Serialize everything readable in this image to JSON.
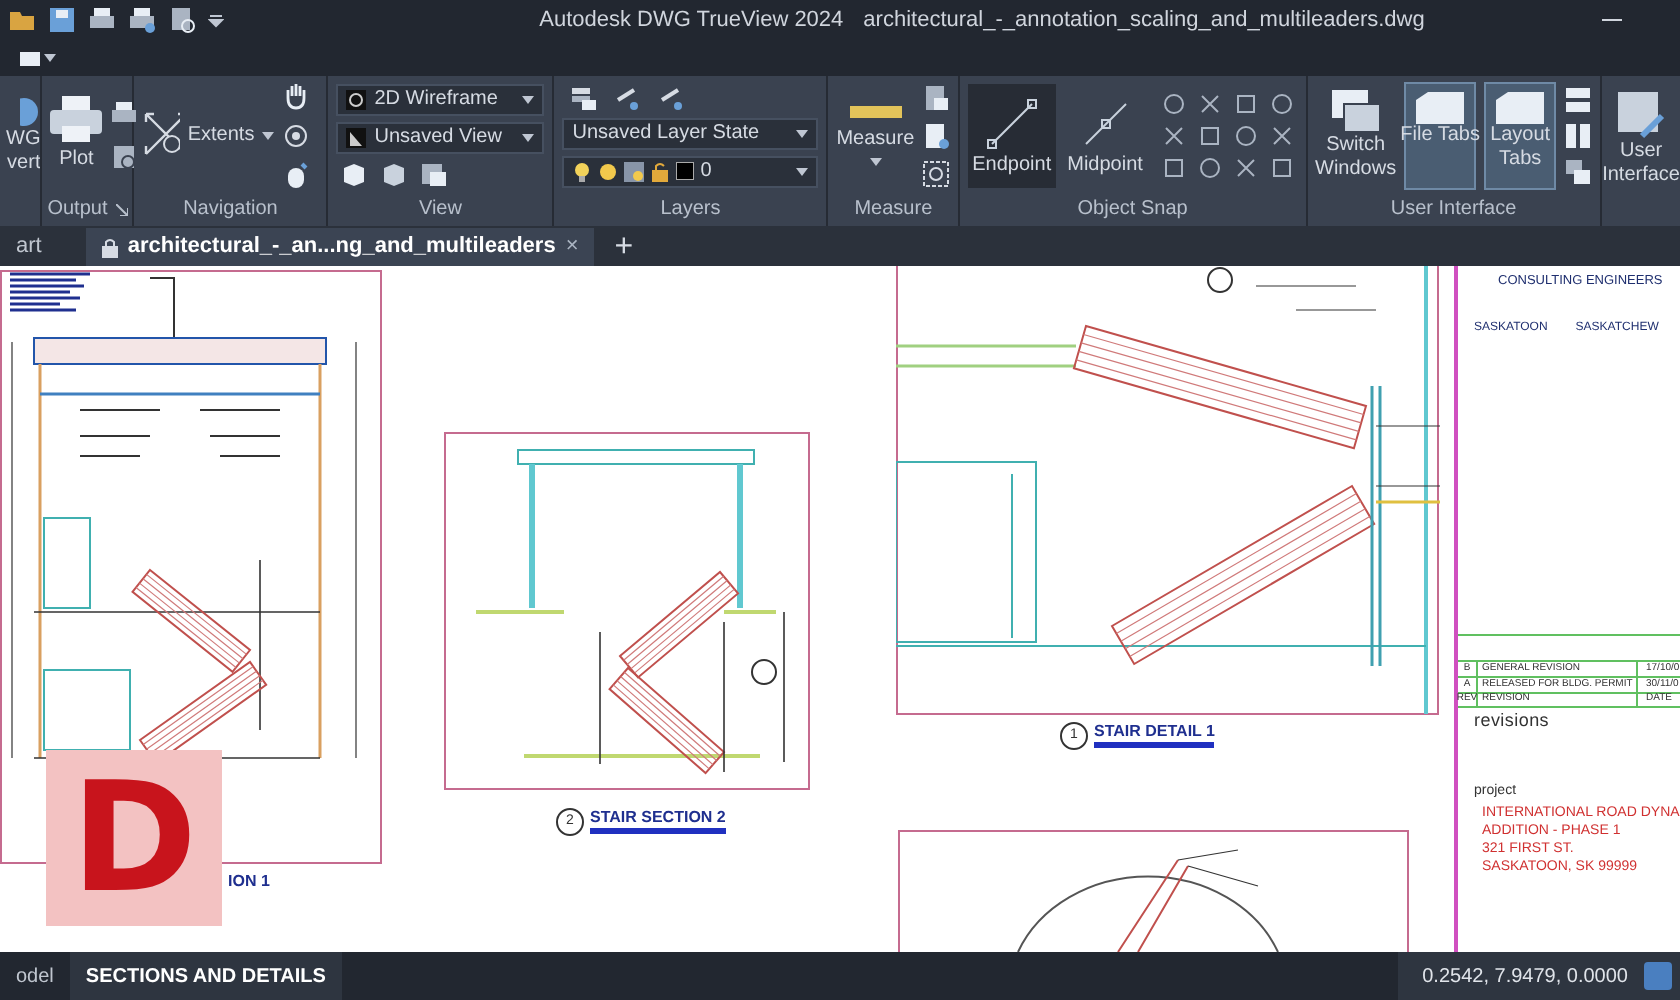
{
  "title_bar": {
    "app_title": "Autodesk DWG TrueView 2024",
    "file_name": "architectural_-_annotation_scaling_and_multileaders.dwg"
  },
  "ribbon": {
    "convert": {
      "lines": [
        "WG",
        "vert"
      ]
    },
    "output": {
      "title": "Output",
      "plot": "Plot"
    },
    "navigation": {
      "title": "Navigation",
      "extents": "Extents"
    },
    "view": {
      "title": "View",
      "visual_style": "2D Wireframe",
      "named_view": "Unsaved View"
    },
    "layers": {
      "title": "Layers",
      "layer_state": "Unsaved Layer State",
      "current_layer": "0"
    },
    "measure": {
      "title": "Measure",
      "label": "Measure"
    },
    "object_snap": {
      "title": "Object Snap",
      "snaps": [
        {
          "label": "Endpoint",
          "selected": true
        },
        {
          "label": "Midpoint",
          "selected": false
        }
      ]
    },
    "user_interface": {
      "title": "User Interface",
      "switch_windows": [
        "Switch",
        "Windows"
      ],
      "toggles": [
        {
          "lines": [
            "File Tabs"
          ],
          "selected": true
        },
        {
          "lines": [
            "Layout",
            "Tabs"
          ],
          "selected": true
        }
      ],
      "ui_button": [
        "User",
        "Interface"
      ]
    }
  },
  "file_tabs": [
    {
      "label": "art",
      "selected": false,
      "locked": false
    },
    {
      "label": "architectural_-_an...ng_and_multileaders",
      "selected": true,
      "locked": true,
      "close": "×"
    }
  ],
  "new_tab": "+",
  "drawing": {
    "section_1_label": "ION 1",
    "section_2": {
      "number": "2",
      "title": "STAIR SECTION 2"
    },
    "detail_1": {
      "number": "1",
      "title": "STAIR DETAIL 1"
    },
    "title_block": {
      "firm": "CONSULTING ENGINEERS",
      "cities": [
        "SASKATOON",
        "SASKATCHEW"
      ],
      "revisions": [
        {
          "mark": "B",
          "description": "GENERAL REVISION",
          "date": "17/10/0"
        },
        {
          "mark": "A",
          "description": "RELEASED FOR BLDG. PERMIT",
          "date": "30/11/0"
        }
      ],
      "revision_header": {
        "mark": "REV",
        "description": "REVISION",
        "date": "DATE"
      },
      "revisions_label": "revisions",
      "project_label": "project",
      "project_lines": [
        "INTERNATIONAL ROAD DYNA",
        "ADDITION - PHASE 1",
        "321 FIRST ST.",
        "SASKATOON,  SK  99999"
      ]
    }
  },
  "logo": {
    "letter": "D"
  },
  "layout_tabs": [
    {
      "label": "odel",
      "selected": false
    },
    {
      "label": "SECTIONS AND DETAILS",
      "selected": true
    }
  ],
  "coordinates": "0.2542, 7.9479, 0.0000"
}
